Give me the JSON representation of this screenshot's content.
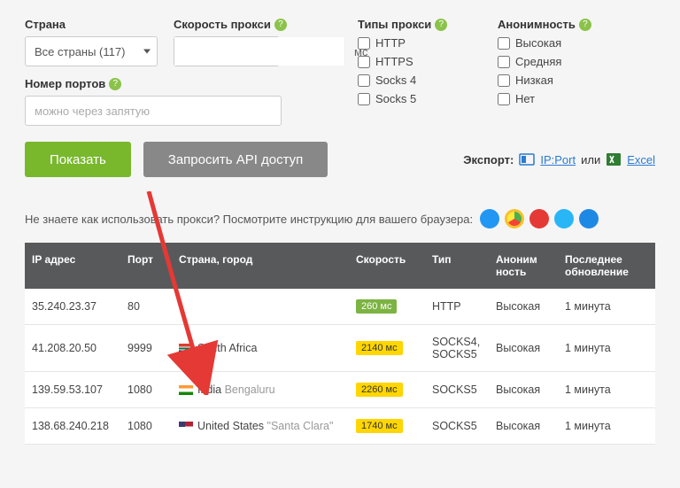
{
  "filters": {
    "country_label": "Страна",
    "country_selected": "Все страны (117)",
    "speed_label": "Скорость прокси",
    "speed_unit": "мс",
    "types_label": "Типы прокси",
    "types": [
      "HTTP",
      "HTTPS",
      "Socks 4",
      "Socks 5"
    ],
    "anon_label": "Анонимность",
    "anon_levels": [
      "Высокая",
      "Средняя",
      "Низкая",
      "Нет"
    ],
    "ports_label": "Номер портов",
    "ports_placeholder": "можно через запятую"
  },
  "buttons": {
    "show": "Показать",
    "api": "Запросить API доступ"
  },
  "export": {
    "label": "Экспорт:",
    "ipport": "IP:Port",
    "or": "или",
    "excel": "Excel"
  },
  "instruction": "Не знаете как использовать прокси? Посмотрите инструкцию для вашего браузера:",
  "table": {
    "headers": {
      "ip": "IP адрес",
      "port": "Порт",
      "country": "Страна, город",
      "speed": "Скорость",
      "type": "Тип",
      "anon": "Аноним ность",
      "update": "Последнее обновление"
    },
    "rows": [
      {
        "ip": "35.240.23.37",
        "port": "80",
        "flag": "",
        "country": "",
        "city": "",
        "speed": "260 мс",
        "speed_cls": "speed-green",
        "type": "HTTP",
        "anon": "Высокая",
        "update": "1 минута"
      },
      {
        "ip": "41.208.20.50",
        "port": "9999",
        "flag": "flag-za",
        "country": "South Africa",
        "city": "",
        "speed": "2140 мс",
        "speed_cls": "speed-yellow",
        "type": "SOCKS4, SOCKS5",
        "anon": "Высокая",
        "update": "1 минута"
      },
      {
        "ip": "139.59.53.107",
        "port": "1080",
        "flag": "flag-in",
        "country": "India",
        "city": "Bengaluru",
        "speed": "2260 мс",
        "speed_cls": "speed-yellow",
        "type": "SOCKS5",
        "anon": "Высокая",
        "update": "1 минута"
      },
      {
        "ip": "138.68.240.218",
        "port": "1080",
        "flag": "flag-us",
        "country": "United States",
        "city": "\"Santa Clara\"",
        "speed": "1740 мс",
        "speed_cls": "speed-yellow",
        "type": "SOCKS5",
        "anon": "Высокая",
        "update": "1 минута"
      }
    ]
  }
}
